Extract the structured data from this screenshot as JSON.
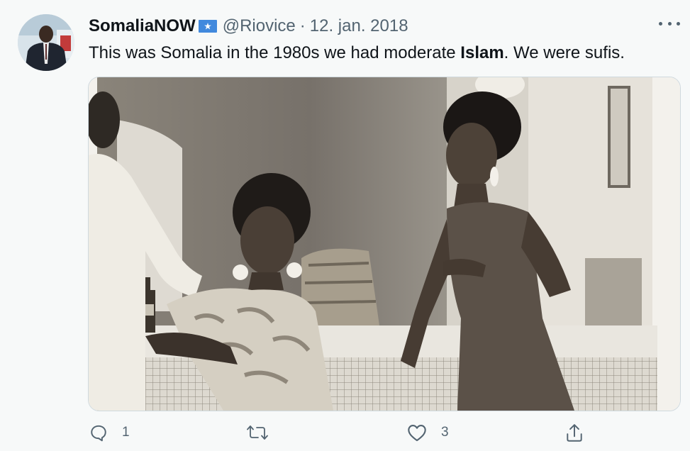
{
  "tweet": {
    "display_name": "SomaliaNOW",
    "handle": "@Riovice",
    "separator": "·",
    "date": "12. jan. 2018",
    "text_before": "This was Somalia in the 1980s we had moderate ",
    "text_bold": "Islam",
    "text_after": ". We were sufis."
  },
  "actions": {
    "reply_count": "1",
    "like_count": "3"
  },
  "icons": {
    "verified_flag": "somalia-flag-icon",
    "more": "more-icon",
    "reply": "reply-icon",
    "retweet": "retweet-icon",
    "like": "like-icon",
    "share": "share-icon"
  },
  "colors": {
    "background": "#f7f9f9",
    "text": "#0f1419",
    "secondary_text": "#536471",
    "flag_blue": "#4189dd"
  }
}
